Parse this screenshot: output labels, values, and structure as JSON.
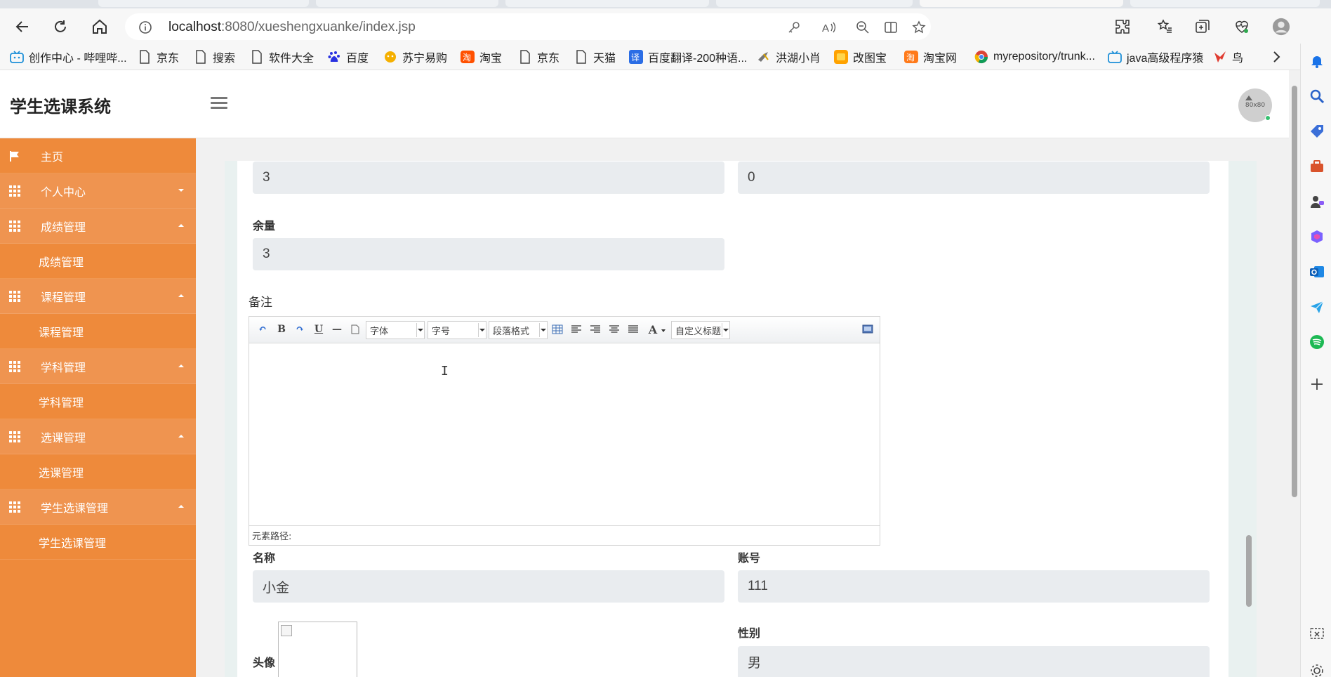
{
  "browser": {
    "url_host": "localhost",
    "url_path": ":8080/xueshengxuanke/index.jsp",
    "bookmarks": [
      {
        "label": "创作中心 - 哔哩哔...",
        "icon": "bilibili-icon"
      },
      {
        "label": "京东",
        "icon": "page-icon"
      },
      {
        "label": "搜索",
        "icon": "page-icon"
      },
      {
        "label": "软件大全",
        "icon": "page-icon"
      },
      {
        "label": "百度",
        "icon": "baidu-icon"
      },
      {
        "label": "苏宁易购",
        "icon": "suning-icon"
      },
      {
        "label": "淘宝",
        "icon": "taobao-icon"
      },
      {
        "label": "京东",
        "icon": "page-icon"
      },
      {
        "label": "天猫",
        "icon": "page-icon"
      },
      {
        "label": "百度翻译-200种语...",
        "icon": "translate-icon"
      },
      {
        "label": "洪湖小肖",
        "icon": "bird-icon"
      },
      {
        "label": "改图宝",
        "icon": "image-icon"
      },
      {
        "label": "淘宝网",
        "icon": "taobao-icon"
      },
      {
        "label": "myrepository/trunk...",
        "icon": "chrome-icon"
      },
      {
        "label": "java高级程序猿",
        "icon": "bilibili-icon"
      },
      {
        "label": "鸟",
        "icon": "bird-icon"
      }
    ],
    "colors": {
      "accent": "#0078d4"
    }
  },
  "app": {
    "title": "学生选课系统",
    "avatar_text": "80x80",
    "sidebar": [
      {
        "label": "主页",
        "type": "home",
        "icon": "flag-icon"
      },
      {
        "label": "个人中心",
        "type": "parent",
        "caret": "down",
        "icon": "grid-icon"
      },
      {
        "label": "成绩管理",
        "type": "parent",
        "caret": "up",
        "icon": "grid-icon"
      },
      {
        "label": "成绩管理",
        "type": "child"
      },
      {
        "label": "课程管理",
        "type": "parent",
        "caret": "up",
        "icon": "grid-icon"
      },
      {
        "label": "课程管理",
        "type": "child"
      },
      {
        "label": "学科管理",
        "type": "parent",
        "caret": "up",
        "icon": "grid-icon"
      },
      {
        "label": "学科管理",
        "type": "child"
      },
      {
        "label": "选课管理",
        "type": "parent",
        "caret": "up",
        "icon": "grid-icon"
      },
      {
        "label": "选课管理",
        "type": "child"
      },
      {
        "label": "学生选课管理",
        "type": "parent",
        "caret": "up",
        "icon": "grid-icon"
      },
      {
        "label": "学生选课管理",
        "type": "child"
      }
    ],
    "colors": {
      "sidebar": "#ee8a3b",
      "field_bg": "#e9ecef"
    }
  },
  "form": {
    "top_left_value": "3",
    "top_right_value": "0",
    "yuliang_label": "余量",
    "yuliang_value": "3",
    "beizhu_label": "备注",
    "editor": {
      "font_label": "字体",
      "size_label": "字号",
      "para_label": "段落格式",
      "custom_label": "自定义标题",
      "status_label": "元素路径:"
    },
    "mingcheng_label": "名称",
    "mingcheng_value": "小金",
    "zhanghao_label": "账号",
    "zhanghao_value": "111",
    "touxiang_label": "头像",
    "xingbie_label": "性别",
    "xingbie_value": "男"
  }
}
